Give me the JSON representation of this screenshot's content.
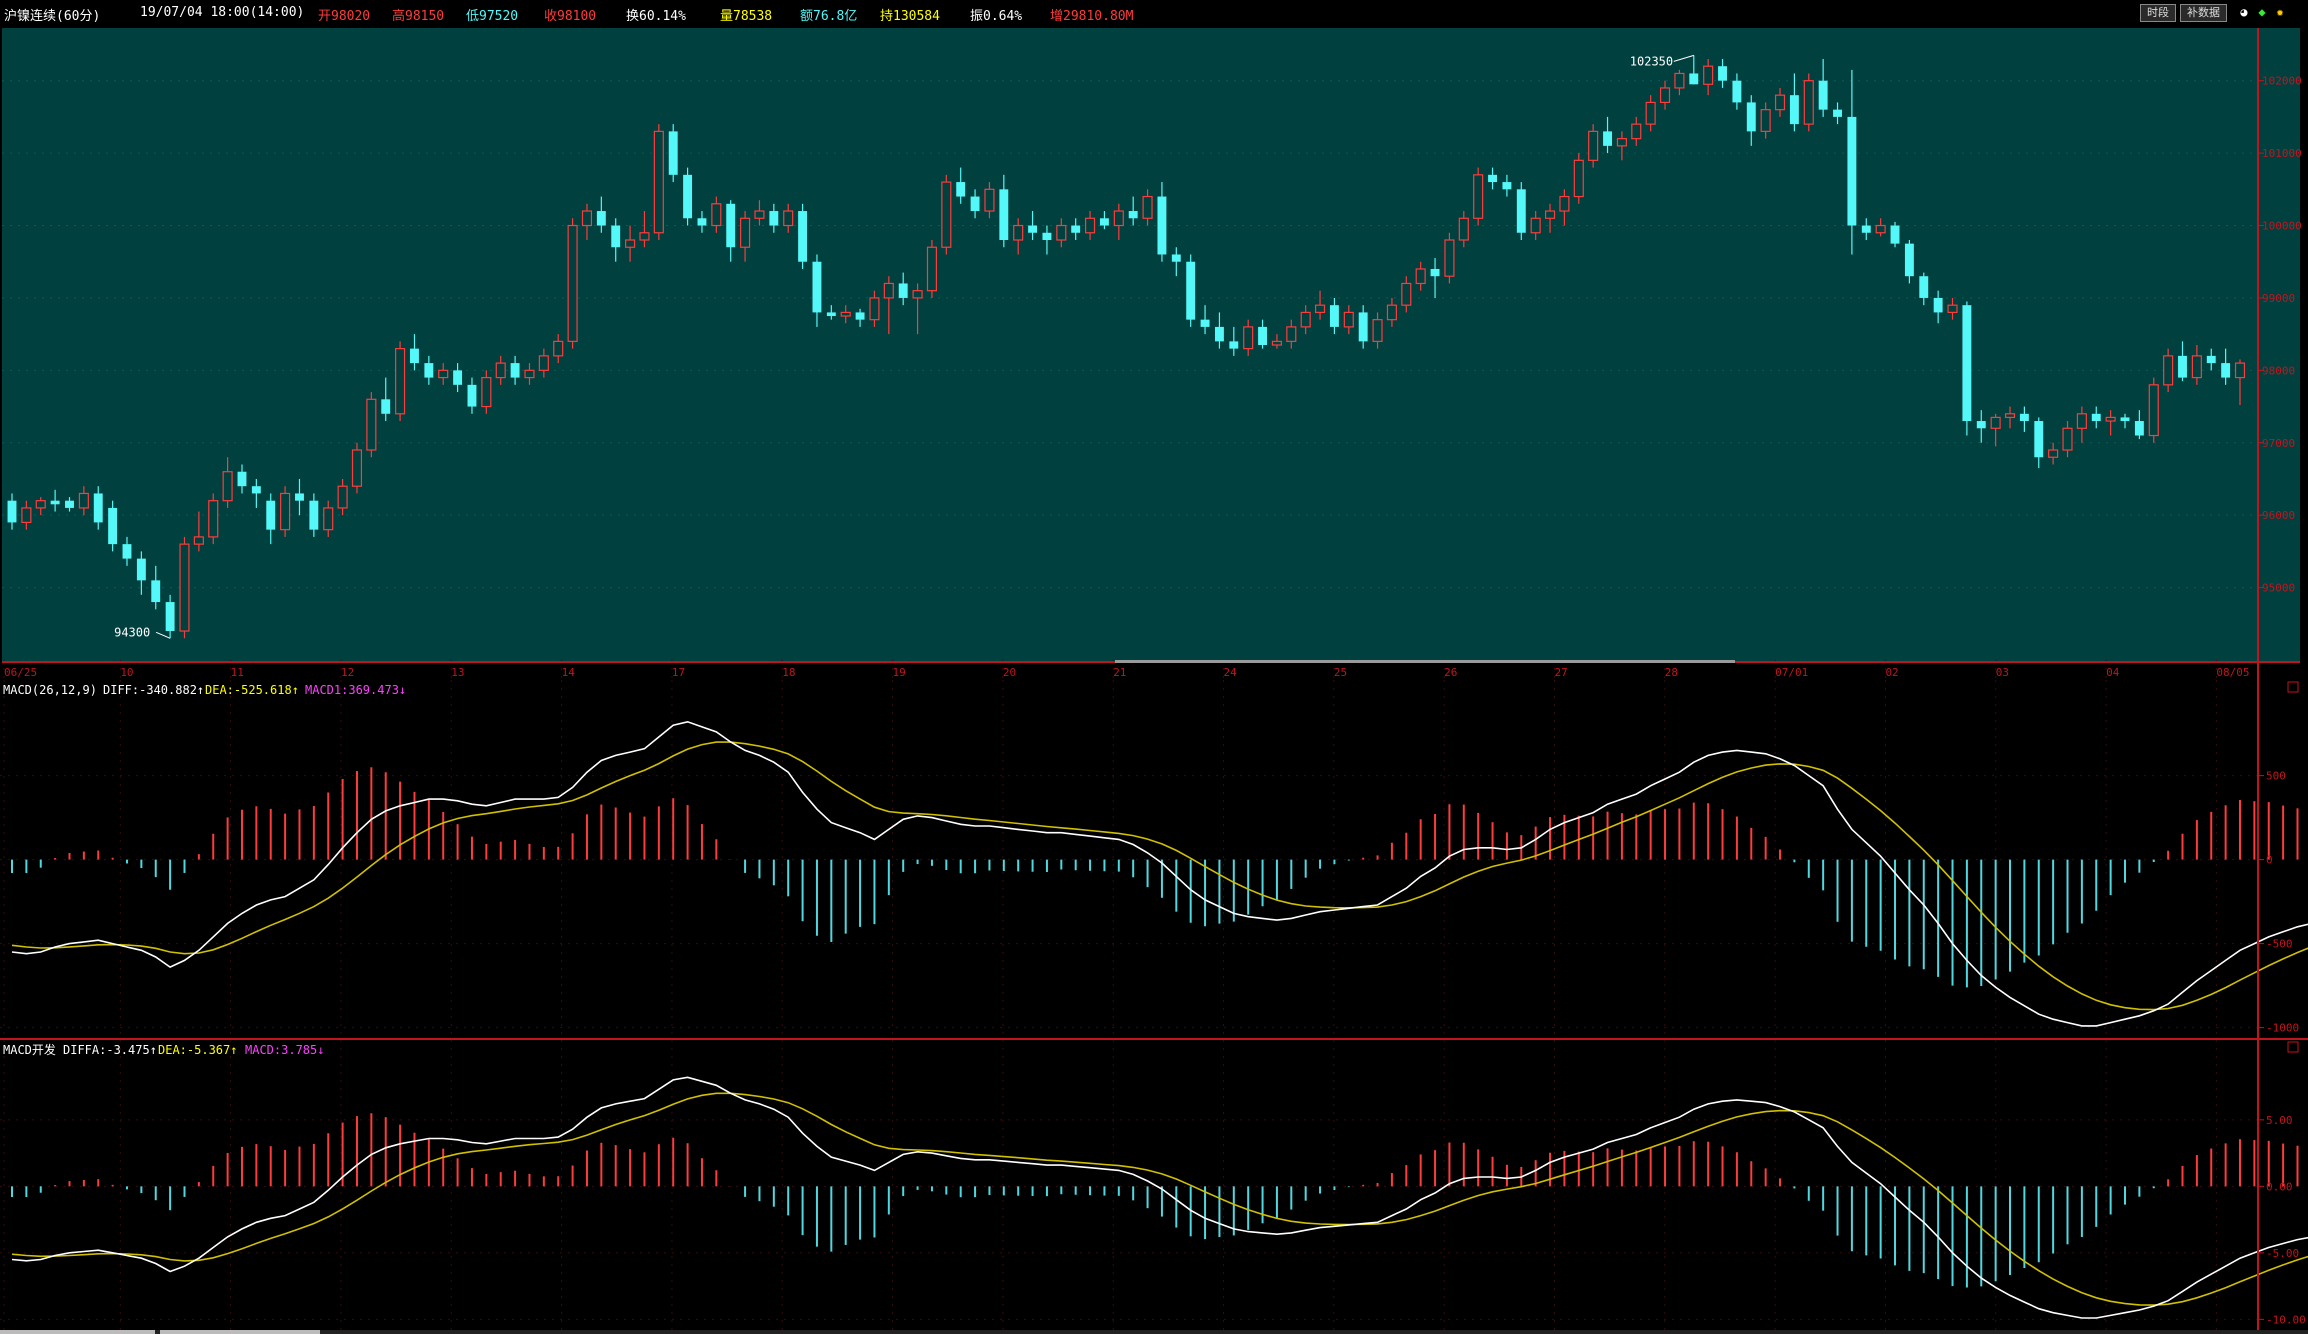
{
  "header": {
    "title": "沪镍连续(60分)",
    "datetime": "19/07/04 18:00(14:00)",
    "open": "开98020",
    "high": "高98150",
    "low": "低97520",
    "close": "收98100",
    "turnover_rate": "换60.14%",
    "volume": "量78538",
    "amount": "额76.8亿",
    "open_interest": "持130584",
    "amplitude": "振0.64%",
    "extra": "增29810.80M",
    "buttons": [
      "时段",
      "补数据"
    ]
  },
  "colors": {
    "up": "#ff3b3b",
    "down": "#54f8f8",
    "main_bg": "#00403f",
    "frame": "#c0151e",
    "diff_line": "#ffffff",
    "dea_line": "#d0c000",
    "macd_label": "#ff40ff"
  },
  "main_chart": {
    "y_ticks": [
      "102000",
      "101000",
      "100000",
      "99000",
      "98000",
      "97000",
      "96000",
      "95000"
    ],
    "x_ticks": [
      "06/25",
      "10",
      "11",
      "12",
      "13",
      "14",
      "17",
      "18",
      "19",
      "20",
      "21",
      "24",
      "25",
      "26",
      "27",
      "28",
      "07/01",
      "02",
      "03",
      "04",
      "08/05"
    ],
    "high_marker": "102350",
    "low_marker": "94300"
  },
  "macd1": {
    "title": "MACD(26,12,9)",
    "diff": "DIFF:-340.882↑",
    "dea": "DEA:-525.618↑",
    "macd": "MACD1:369.473↓",
    "y_ticks": [
      "500",
      "0",
      "-500",
      "-1000"
    ]
  },
  "macd2": {
    "title": "MACD开发",
    "diff": "DIFFA:-3.475↑",
    "dea": "DEA:-5.367↑",
    "macd": "MACD:3.785↓",
    "y_ticks": [
      "5.00",
      "0.00",
      "-5.00",
      "-10.00"
    ]
  },
  "chart_data": [
    {
      "type": "candlestick",
      "title": "沪镍连续(60分)",
      "x_tick_labels": [
        "06/25",
        "10",
        "11",
        "12",
        "13",
        "14",
        "17",
        "18",
        "19",
        "20",
        "21",
        "24",
        "25",
        "26",
        "27",
        "28",
        "07/01",
        "02",
        "03",
        "04",
        "08/05"
      ],
      "ylim": [
        94000,
        102700
      ],
      "ohlc": [
        [
          96200,
          96300,
          95800,
          95900
        ],
        [
          95900,
          96200,
          95800,
          96100
        ],
        [
          96100,
          96250,
          96000,
          96200
        ],
        [
          96200,
          96350,
          96050,
          96150
        ],
        [
          96200,
          96250,
          96050,
          96100
        ],
        [
          96100,
          96400,
          96000,
          96300
        ],
        [
          96300,
          96400,
          95800,
          95900
        ],
        [
          96100,
          96200,
          95500,
          95600
        ],
        [
          95600,
          95700,
          95300,
          95400
        ],
        [
          95400,
          95500,
          94900,
          95100
        ],
        [
          95100,
          95300,
          94700,
          94800
        ],
        [
          94800,
          94900,
          94300,
          94400
        ],
        [
          94400,
          95700,
          94300,
          95600
        ],
        [
          95600,
          96050,
          95500,
          95700
        ],
        [
          95700,
          96300,
          95600,
          96200
        ],
        [
          96200,
          96800,
          96100,
          96600
        ],
        [
          96600,
          96700,
          96300,
          96400
        ],
        [
          96400,
          96500,
          96100,
          96300
        ],
        [
          96200,
          96300,
          95600,
          95800
        ],
        [
          95800,
          96400,
          95700,
          96300
        ],
        [
          96300,
          96500,
          96000,
          96200
        ],
        [
          96200,
          96300,
          95700,
          95800
        ],
        [
          95800,
          96200,
          95700,
          96100
        ],
        [
          96100,
          96500,
          96000,
          96400
        ],
        [
          96400,
          97000,
          96300,
          96900
        ],
        [
          96900,
          97700,
          96800,
          97600
        ],
        [
          97600,
          97900,
          97300,
          97400
        ],
        [
          97400,
          98400,
          97300,
          98300
        ],
        [
          98300,
          98500,
          98000,
          98100
        ],
        [
          98100,
          98200,
          97800,
          97900
        ],
        [
          97900,
          98100,
          97800,
          98000
        ],
        [
          98000,
          98100,
          97700,
          97800
        ],
        [
          97800,
          97900,
          97400,
          97500
        ],
        [
          97500,
          98000,
          97400,
          97900
        ],
        [
          97900,
          98200,
          97800,
          98100
        ],
        [
          98100,
          98200,
          97800,
          97900
        ],
        [
          97900,
          98100,
          97800,
          98000
        ],
        [
          98000,
          98300,
          97900,
          98200
        ],
        [
          98200,
          98500,
          98100,
          98400
        ],
        [
          98400,
          100100,
          98300,
          100000
        ],
        [
          100000,
          100300,
          99800,
          100200
        ],
        [
          100200,
          100400,
          99900,
          100000
        ],
        [
          100000,
          100100,
          99500,
          99700
        ],
        [
          99700,
          100000,
          99500,
          99800
        ],
        [
          99800,
          100200,
          99700,
          99900
        ],
        [
          99900,
          101400,
          99800,
          101300
        ],
        [
          101300,
          101400,
          100600,
          100700
        ],
        [
          100700,
          100800,
          100000,
          100100
        ],
        [
          100100,
          100200,
          99900,
          100000
        ],
        [
          100000,
          100400,
          99900,
          100300
        ],
        [
          100300,
          100350,
          99500,
          99700
        ],
        [
          99700,
          100200,
          99500,
          100100
        ],
        [
          100100,
          100350,
          100000,
          100200
        ],
        [
          100200,
          100300,
          99900,
          100000
        ],
        [
          100000,
          100300,
          99900,
          100200
        ],
        [
          100200,
          100300,
          99400,
          99500
        ],
        [
          99500,
          99600,
          98600,
          98800
        ],
        [
          98800,
          98900,
          98700,
          98750
        ],
        [
          98750,
          98900,
          98650,
          98800
        ],
        [
          98800,
          98850,
          98600,
          98700
        ],
        [
          98700,
          99100,
          98600,
          99000
        ],
        [
          99000,
          99300,
          98500,
          99200
        ],
        [
          99200,
          99350,
          98900,
          99000
        ],
        [
          99000,
          99200,
          98500,
          99100
        ],
        [
          99100,
          99800,
          99000,
          99700
        ],
        [
          99700,
          100700,
          99600,
          100600
        ],
        [
          100600,
          100800,
          100300,
          100400
        ],
        [
          100400,
          100500,
          100100,
          100200
        ],
        [
          100200,
          100600,
          100100,
          100500
        ],
        [
          100500,
          100700,
          99700,
          99800
        ],
        [
          99800,
          100100,
          99600,
          100000
        ],
        [
          100000,
          100200,
          99800,
          99900
        ],
        [
          99900,
          100000,
          99600,
          99800
        ],
        [
          99800,
          100100,
          99700,
          100000
        ],
        [
          100000,
          100100,
          99800,
          99900
        ],
        [
          99900,
          100200,
          99800,
          100100
        ],
        [
          100100,
          100200,
          99950,
          100000
        ],
        [
          100000,
          100300,
          99800,
          100200
        ],
        [
          100200,
          100400,
          100000,
          100100
        ],
        [
          100100,
          100500,
          100000,
          100400
        ],
        [
          100400,
          100600,
          99500,
          99600
        ],
        [
          99600,
          99700,
          99300,
          99500
        ],
        [
          99500,
          99600,
          98600,
          98700
        ],
        [
          98700,
          98900,
          98500,
          98600
        ],
        [
          98600,
          98800,
          98300,
          98400
        ],
        [
          98400,
          98600,
          98200,
          98300
        ],
        [
          98300,
          98700,
          98200,
          98600
        ],
        [
          98600,
          98700,
          98300,
          98350
        ],
        [
          98350,
          98500,
          98300,
          98400
        ],
        [
          98400,
          98700,
          98300,
          98600
        ],
        [
          98600,
          98900,
          98500,
          98800
        ],
        [
          98800,
          99100,
          98700,
          98900
        ],
        [
          98900,
          99000,
          98500,
          98600
        ],
        [
          98600,
          98900,
          98500,
          98800
        ],
        [
          98800,
          98900,
          98300,
          98400
        ],
        [
          98400,
          98800,
          98300,
          98700
        ],
        [
          98700,
          99000,
          98600,
          98900
        ],
        [
          98900,
          99300,
          98800,
          99200
        ],
        [
          99200,
          99500,
          99100,
          99400
        ],
        [
          99400,
          99550,
          99000,
          99300
        ],
        [
          99300,
          99900,
          99200,
          99800
        ],
        [
          99800,
          100200,
          99700,
          100100
        ],
        [
          100100,
          100800,
          100000,
          100700
        ],
        [
          100700,
          100800,
          100500,
          100600
        ],
        [
          100600,
          100700,
          100400,
          100500
        ],
        [
          100500,
          100600,
          99800,
          99900
        ],
        [
          99900,
          100200,
          99800,
          100100
        ],
        [
          100100,
          100300,
          99900,
          100200
        ],
        [
          100200,
          100500,
          100000,
          100400
        ],
        [
          100400,
          101000,
          100300,
          100900
        ],
        [
          100900,
          101400,
          100800,
          101300
        ],
        [
          101300,
          101500,
          101000,
          101100
        ],
        [
          101100,
          101300,
          100900,
          101200
        ],
        [
          101200,
          101500,
          101100,
          101400
        ],
        [
          101400,
          101800,
          101300,
          101700
        ],
        [
          101700,
          102000,
          101600,
          101900
        ],
        [
          101900,
          102150,
          101800,
          102100
        ],
        [
          102100,
          102350,
          101950,
          101950
        ],
        [
          101950,
          102300,
          101800,
          102200
        ],
        [
          102200,
          102300,
          101900,
          102000
        ],
        [
          102000,
          102100,
          101600,
          101700
        ],
        [
          101700,
          101800,
          101100,
          101300
        ],
        [
          101300,
          101700,
          101200,
          101600
        ],
        [
          101600,
          101900,
          101500,
          101800
        ],
        [
          101800,
          102100,
          101300,
          101400
        ],
        [
          101400,
          102100,
          101300,
          102000
        ],
        [
          102000,
          102300,
          101500,
          101600
        ],
        [
          101600,
          101700,
          101400,
          101500
        ],
        [
          101500,
          102150,
          99600,
          100000
        ],
        [
          100000,
          100100,
          99800,
          99900
        ],
        [
          99900,
          100100,
          99850,
          100000
        ],
        [
          100000,
          100050,
          99700,
          99750
        ],
        [
          99750,
          99800,
          99200,
          99300
        ],
        [
          99300,
          99350,
          98900,
          99000
        ],
        [
          99000,
          99100,
          98650,
          98800
        ],
        [
          98800,
          99000,
          98700,
          98900
        ],
        [
          98900,
          98950,
          97100,
          97300
        ],
        [
          97300,
          97450,
          97000,
          97200
        ],
        [
          97200,
          97400,
          96950,
          97350
        ],
        [
          97350,
          97500,
          97200,
          97400
        ],
        [
          97400,
          97500,
          97150,
          97300
        ],
        [
          97300,
          97350,
          96650,
          96800
        ],
        [
          96800,
          97000,
          96700,
          96900
        ],
        [
          96900,
          97300,
          96800,
          97200
        ],
        [
          97200,
          97500,
          97000,
          97400
        ],
        [
          97400,
          97500,
          97200,
          97300
        ],
        [
          97300,
          97450,
          97100,
          97350
        ],
        [
          97350,
          97400,
          97200,
          97300
        ],
        [
          97300,
          97450,
          97050,
          97100
        ],
        [
          97100,
          97900,
          97000,
          97800
        ],
        [
          97800,
          98300,
          97700,
          98200
        ],
        [
          98200,
          98400,
          97850,
          97900
        ],
        [
          97900,
          98350,
          97800,
          98200
        ],
        [
          98200,
          98300,
          98000,
          98100
        ],
        [
          98100,
          98300,
          97800,
          97900
        ],
        [
          97900,
          98150,
          97520,
          98100
        ]
      ]
    },
    {
      "type": "macd",
      "title": "MACD(26,12,9)",
      "ylim": [
        -1050,
        950
      ],
      "diff": [
        -550,
        -560,
        -550,
        -520,
        -500,
        -490,
        -480,
        -500,
        -520,
        -540,
        -580,
        -640,
        -600,
        -540,
        -460,
        -380,
        -320,
        -270,
        -240,
        -220,
        -170,
        -120,
        -30,
        70,
        160,
        240,
        290,
        320,
        340,
        360,
        360,
        350,
        330,
        320,
        340,
        360,
        360,
        360,
        370,
        430,
        520,
        590,
        620,
        640,
        660,
        730,
        800,
        820,
        790,
        760,
        700,
        650,
        620,
        580,
        520,
        400,
        300,
        220,
        190,
        160,
        120,
        180,
        240,
        260,
        250,
        230,
        210,
        200,
        200,
        190,
        180,
        170,
        160,
        160,
        150,
        140,
        130,
        120,
        90,
        40,
        -20,
        -100,
        -180,
        -240,
        -280,
        -320,
        -340,
        -350,
        -360,
        -350,
        -330,
        -310,
        -300,
        -290,
        -280,
        -270,
        -220,
        -170,
        -100,
        -50,
        20,
        60,
        70,
        70,
        60,
        70,
        120,
        180,
        220,
        250,
        280,
        330,
        360,
        390,
        440,
        480,
        520,
        580,
        620,
        640,
        650,
        640,
        630,
        600,
        560,
        500,
        440,
        300,
        180,
        100,
        20,
        -80,
        -180,
        -270,
        -380,
        -500,
        -600,
        -690,
        -760,
        -820,
        -870,
        -920,
        -950,
        -970,
        -990,
        -990,
        -970,
        -950,
        -930,
        -900,
        -860,
        -790,
        -720,
        -660,
        -600,
        -540,
        -500,
        -460,
        -430,
        -400,
        -380,
        -341
      ]
    },
    {
      "type": "macd",
      "title": "MACD开发",
      "ylim": [
        -10.5,
        9.5
      ],
      "diffa_last": -3.475,
      "dea_last": -5.367,
      "macd_last": 3.785
    }
  ]
}
